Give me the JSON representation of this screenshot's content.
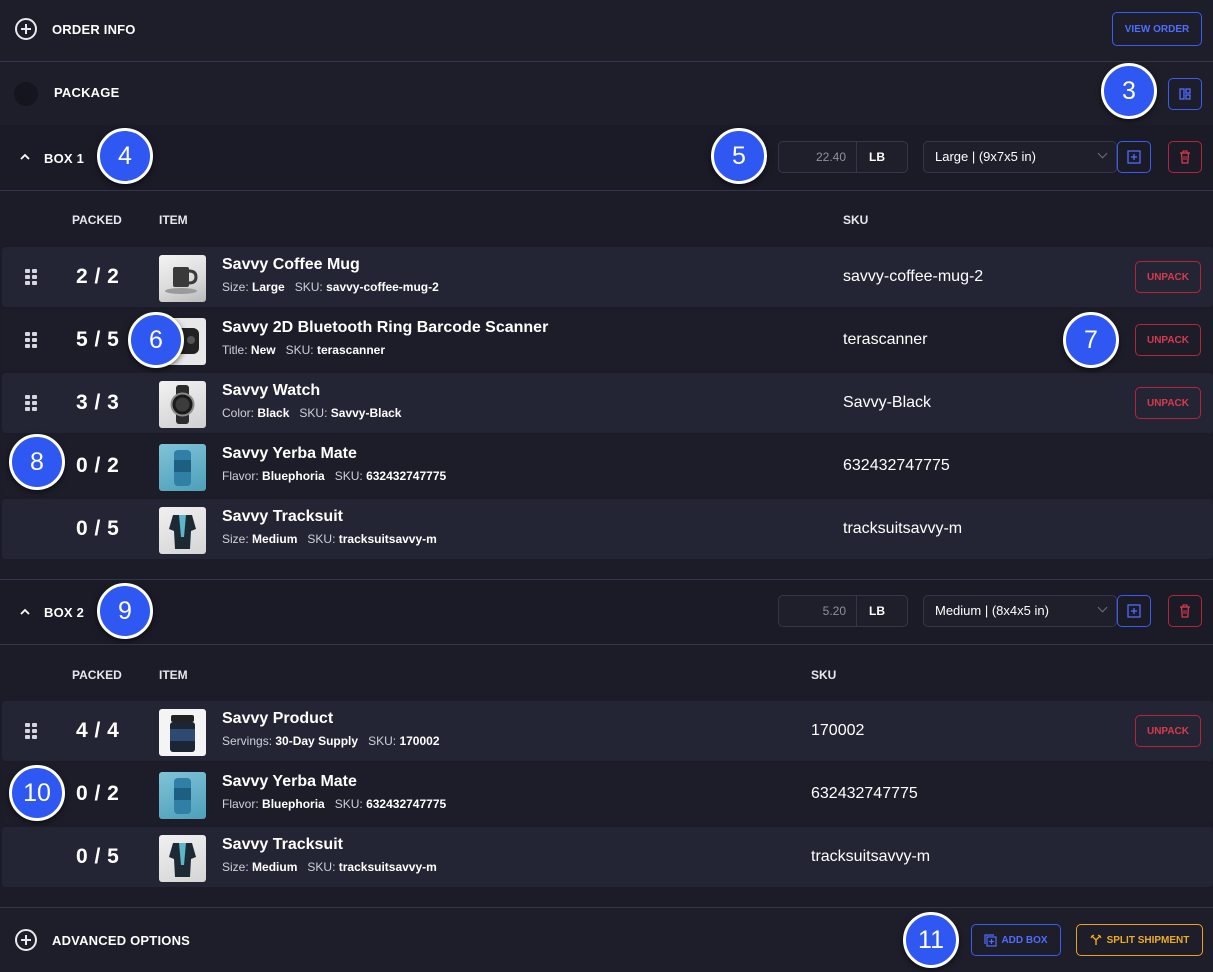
{
  "order_info": {
    "label": "ORDER INFO",
    "view_order": "VIEW ORDER"
  },
  "package": {
    "label": "PACKAGE"
  },
  "boxes": [
    {
      "label": "BOX 1",
      "weight": "22.40",
      "unit": "LB",
      "size": "Large | (9x7x5 in)",
      "columns": {
        "packed": "PACKED",
        "item": "ITEM",
        "sku": "SKU"
      },
      "items": [
        {
          "packed": "2 / 2",
          "name": "Savvy Coffee Mug",
          "attr_label": "Size:",
          "attr_value": "Large",
          "sku_label": "SKU:",
          "sku_value": "savvy-coffee-mug-2",
          "sku": "savvy-coffee-mug-2",
          "unpack": "UNPACK"
        },
        {
          "packed": "5 / 5",
          "name": "Savvy 2D Bluetooth Ring Barcode Scanner",
          "attr_label": "Title:",
          "attr_value": "New",
          "sku_label": "SKU:",
          "sku_value": "terascanner",
          "sku": "terascanner",
          "unpack": "UNPACK"
        },
        {
          "packed": "3 / 3",
          "name": "Savvy Watch",
          "attr_label": "Color:",
          "attr_value": "Black",
          "sku_label": "SKU:",
          "sku_value": "Savvy-Black",
          "sku": "Savvy-Black",
          "unpack": "UNPACK"
        },
        {
          "packed": "0 / 2",
          "name": "Savvy Yerba Mate",
          "attr_label": "Flavor:",
          "attr_value": "Bluephoria",
          "sku_label": "SKU:",
          "sku_value": "632432747775",
          "sku": "632432747775"
        },
        {
          "packed": "0 / 5",
          "name": "Savvy Tracksuit",
          "attr_label": "Size:",
          "attr_value": "Medium",
          "sku_label": "SKU:",
          "sku_value": "tracksuitsavvy-m",
          "sku": "tracksuitsavvy-m"
        }
      ]
    },
    {
      "label": "BOX 2",
      "weight": "5.20",
      "unit": "LB",
      "size": "Medium | (8x4x5 in)",
      "columns": {
        "packed": "PACKED",
        "item": "ITEM",
        "sku": "SKU"
      },
      "items": [
        {
          "packed": "4 / 4",
          "name": "Savvy Product",
          "attr_label": "Servings:",
          "attr_value": "30-Day Supply",
          "sku_label": "SKU:",
          "sku_value": "170002",
          "sku": "170002",
          "unpack": "UNPACK"
        },
        {
          "packed": "0 / 2",
          "name": "Savvy Yerba Mate",
          "attr_label": "Flavor:",
          "attr_value": "Bluephoria",
          "sku_label": "SKU:",
          "sku_value": "632432747775",
          "sku": "632432747775"
        },
        {
          "packed": "0 / 5",
          "name": "Savvy Tracksuit",
          "attr_label": "Size:",
          "attr_value": "Medium",
          "sku_label": "SKU:",
          "sku_value": "tracksuitsavvy-m",
          "sku": "tracksuitsavvy-m"
        }
      ]
    }
  ],
  "advanced": {
    "label": "ADVANCED OPTIONS",
    "add_box": "ADD BOX",
    "split_shipment": "SPLIT SHIPMENT"
  },
  "callouts": {
    "c3": "3",
    "c4": "4",
    "c5": "5",
    "c6": "6",
    "c7": "7",
    "c8": "8",
    "c9": "9",
    "c10": "10",
    "c11": "11"
  },
  "colors": {
    "background": "#1b1c27",
    "row": "#232534",
    "accent_blue": "#2f57f2",
    "danger": "#d83a4d",
    "warning": "#f0aa24"
  },
  "icons": [
    "plus-circle-icon",
    "radio-circle-icon",
    "layout-icon",
    "chevron-up-icon",
    "plus-square-icon",
    "trash-icon",
    "drag-handle-icon",
    "add-box-icon",
    "split-icon"
  ]
}
